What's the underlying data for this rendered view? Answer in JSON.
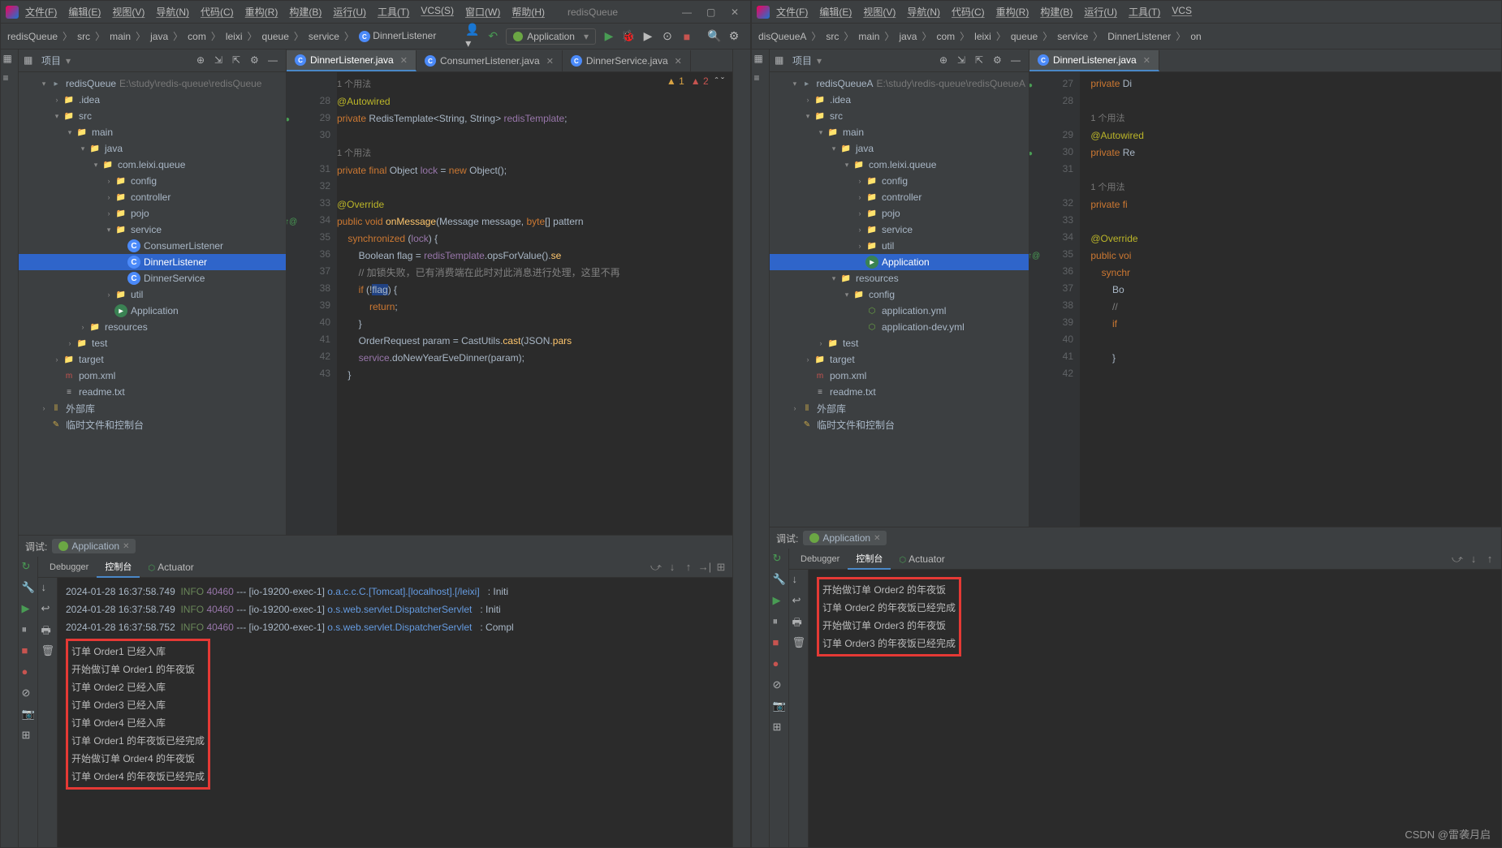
{
  "left": {
    "menu": [
      "文件(F)",
      "编辑(E)",
      "视图(V)",
      "导航(N)",
      "代码(C)",
      "重构(R)",
      "构建(B)",
      "运行(U)",
      "工具(T)",
      "VCS(S)",
      "窗口(W)",
      "帮助(H)"
    ],
    "title": "redisQueue",
    "breadcrumbs": [
      "redisQueue",
      "src",
      "main",
      "java",
      "com",
      "leixi",
      "queue",
      "service",
      "DinnerListener"
    ],
    "runConfig": "Application",
    "projectLabel": "项目",
    "projectRoot": {
      "name": "redisQueue",
      "path": "E:\\study\\redis-queue\\redisQueue"
    },
    "tree": [
      {
        "d": 1,
        "arr": "▾",
        "i": "proj",
        "t": "redisQueue",
        "path": "E:\\study\\redis-queue\\redisQueue"
      },
      {
        "d": 2,
        "arr": "›",
        "i": "folder",
        "t": ".idea"
      },
      {
        "d": 2,
        "arr": "▾",
        "i": "folder",
        "t": "src"
      },
      {
        "d": 3,
        "arr": "▾",
        "i": "folder",
        "t": "main"
      },
      {
        "d": 4,
        "arr": "▾",
        "i": "folder",
        "t": "java"
      },
      {
        "d": 5,
        "arr": "▾",
        "i": "folder",
        "t": "com.leixi.queue"
      },
      {
        "d": 6,
        "arr": "›",
        "i": "folder",
        "t": "config"
      },
      {
        "d": 6,
        "arr": "›",
        "i": "folder",
        "t": "controller"
      },
      {
        "d": 6,
        "arr": "›",
        "i": "folder",
        "t": "pojo"
      },
      {
        "d": 6,
        "arr": "▾",
        "i": "folder",
        "t": "service"
      },
      {
        "d": 7,
        "arr": "",
        "i": "cls",
        "t": "ConsumerListener"
      },
      {
        "d": 7,
        "arr": "",
        "i": "cls",
        "t": "DinnerListener",
        "sel": true
      },
      {
        "d": 7,
        "arr": "",
        "i": "cls",
        "t": "DinnerService"
      },
      {
        "d": 6,
        "arr": "›",
        "i": "folder",
        "t": "util"
      },
      {
        "d": 6,
        "arr": "",
        "i": "clsm",
        "t": "Application"
      },
      {
        "d": 4,
        "arr": "›",
        "i": "folder",
        "t": "resources"
      },
      {
        "d": 3,
        "arr": "›",
        "i": "folder",
        "t": "test"
      },
      {
        "d": 2,
        "arr": "›",
        "i": "folder-o",
        "t": "target"
      },
      {
        "d": 2,
        "arr": "",
        "i": "xml",
        "t": "pom.xml"
      },
      {
        "d": 2,
        "arr": "",
        "i": "txt",
        "t": "readme.txt"
      },
      {
        "d": 1,
        "arr": "›",
        "i": "lib",
        "t": "外部库"
      },
      {
        "d": 1,
        "arr": "",
        "i": "scratch",
        "t": "临时文件和控制台"
      }
    ],
    "tabs": [
      {
        "name": "DinnerListener.java",
        "active": true
      },
      {
        "name": "ConsumerListener.java"
      },
      {
        "name": "DinnerService.java"
      }
    ],
    "warnings": {
      "warn": "1",
      "weak": "2"
    },
    "hint": "1 个用法",
    "code": [
      {
        "n": "",
        "html": "<span class='hint'>1 个用法</span>"
      },
      {
        "n": "28",
        "html": "<span class='ann'>@Autowired</span>"
      },
      {
        "n": "29",
        "ic": "●",
        "html": "<span class='kw'>private</span> RedisTemplate&lt;String, String&gt; <span class='fld'>redisTemplate</span>;"
      },
      {
        "n": "30",
        "html": ""
      },
      {
        "n": "",
        "html": "<span class='hint'>1 个用法</span>"
      },
      {
        "n": "31",
        "html": "<span class='kw'>private final</span> Object <span class='fld'>lock</span> = <span class='kw'>new</span> Object();"
      },
      {
        "n": "32",
        "html": ""
      },
      {
        "n": "33",
        "html": "<span class='ann'>@Override</span>"
      },
      {
        "n": "34",
        "ic": "↑@",
        "html": "<span class='kw'>public void</span> <span class='fn'>onMessage</span>(Message message, <span class='kw'>byte</span>[] pattern"
      },
      {
        "n": "35",
        "html": "    <span class='kw'>synchronized</span> (<span class='fld'>lock</span>) {"
      },
      {
        "n": "36",
        "html": "        Boolean flag = <span class='fld'>redisTemplate</span>.opsForValue().<span class='fn'>se</span>"
      },
      {
        "n": "37",
        "html": "        <span class='com'>// 加锁失败，已有消费端在此时对此消息进行处理，这里不再</span>"
      },
      {
        "n": "38",
        "html": "        <span class='kw'>if</span> (!<span style='background:#214283'>flag</span>) {"
      },
      {
        "n": "39",
        "html": "            <span class='kw'>return</span>;"
      },
      {
        "n": "40",
        "html": "        }"
      },
      {
        "n": "41",
        "html": "        OrderRequest param = CastUtils.<span class='fn'>cast</span>(JSON.<span class='fn'>pars</span>"
      },
      {
        "n": "42",
        "html": "        <span class='fld'>service</span>.doNewYearEveDinner(param);"
      },
      {
        "n": "43",
        "html": "    }"
      }
    ],
    "debugLabel": "调试:",
    "debugTab": "Application",
    "subtabs": [
      "Debugger",
      "控制台",
      "Actuator"
    ],
    "subtabActive": 1,
    "logLines": [
      {
        "ts": "2024-01-28 16:37:58.749",
        "lvl": "INFO",
        "pid": "40460",
        "thread": "[io-19200-exec-1]",
        "logger": "o.a.c.c.C.[Tomcat].[localhost].[/leixi]",
        "msg": ": Initi"
      },
      {
        "ts": "2024-01-28 16:37:58.749",
        "lvl": "INFO",
        "pid": "40460",
        "thread": "[io-19200-exec-1]",
        "logger": "o.s.web.servlet.DispatcherServlet",
        "msg": ": Initi"
      },
      {
        "ts": "2024-01-28 16:37:58.752",
        "lvl": "INFO",
        "pid": "40460",
        "thread": "[io-19200-exec-1]",
        "logger": "o.s.web.servlet.DispatcherServlet",
        "msg": ": Compl"
      }
    ],
    "boxed": [
      "订单 Order1 已经入库",
      "开始做订单 Order1 的年夜饭",
      "订单 Order2 已经入库",
      "订单 Order3 已经入库",
      "订单 Order4 已经入库",
      "订单 Order1 的年夜饭已经完成",
      "开始做订单 Order4 的年夜饭",
      "订单 Order4 的年夜饭已经完成"
    ]
  },
  "right": {
    "menu": [
      "文件(F)",
      "编辑(E)",
      "视图(V)",
      "导航(N)",
      "代码(C)",
      "重构(R)",
      "构建(B)",
      "运行(U)",
      "工具(T)",
      "VCS"
    ],
    "breadcrumbs": [
      "disQueueA",
      "src",
      "main",
      "java",
      "com",
      "leixi",
      "queue",
      "service",
      "DinnerListener",
      "on"
    ],
    "projectLabel": "项目",
    "tree": [
      {
        "d": 1,
        "arr": "▾",
        "i": "proj",
        "t": "redisQueueA",
        "path": "E:\\study\\redis-queue\\redisQueueA"
      },
      {
        "d": 2,
        "arr": "›",
        "i": "folder",
        "t": ".idea"
      },
      {
        "d": 2,
        "arr": "▾",
        "i": "folder",
        "t": "src"
      },
      {
        "d": 3,
        "arr": "▾",
        "i": "folder",
        "t": "main"
      },
      {
        "d": 4,
        "arr": "▾",
        "i": "folder",
        "t": "java"
      },
      {
        "d": 5,
        "arr": "▾",
        "i": "folder",
        "t": "com.leixi.queue"
      },
      {
        "d": 6,
        "arr": "›",
        "i": "folder",
        "t": "config"
      },
      {
        "d": 6,
        "arr": "›",
        "i": "folder",
        "t": "controller"
      },
      {
        "d": 6,
        "arr": "›",
        "i": "folder",
        "t": "pojo"
      },
      {
        "d": 6,
        "arr": "›",
        "i": "folder",
        "t": "service"
      },
      {
        "d": 6,
        "arr": "›",
        "i": "folder",
        "t": "util"
      },
      {
        "d": 6,
        "arr": "",
        "i": "clsm",
        "t": "Application",
        "sel": true
      },
      {
        "d": 4,
        "arr": "▾",
        "i": "folder",
        "t": "resources"
      },
      {
        "d": 5,
        "arr": "▾",
        "i": "folder",
        "t": "config"
      },
      {
        "d": 6,
        "arr": "",
        "i": "yml",
        "t": "application.yml"
      },
      {
        "d": 6,
        "arr": "",
        "i": "yml",
        "t": "application-dev.yml"
      },
      {
        "d": 3,
        "arr": "›",
        "i": "folder",
        "t": "test"
      },
      {
        "d": 2,
        "arr": "›",
        "i": "folder-o",
        "t": "target"
      },
      {
        "d": 2,
        "arr": "",
        "i": "xml",
        "t": "pom.xml"
      },
      {
        "d": 2,
        "arr": "",
        "i": "txt",
        "t": "readme.txt"
      },
      {
        "d": 1,
        "arr": "›",
        "i": "lib",
        "t": "外部库"
      },
      {
        "d": 1,
        "arr": "",
        "i": "scratch",
        "t": "临时文件和控制台"
      }
    ],
    "tabs": [
      {
        "name": "DinnerListener.java",
        "active": true
      }
    ],
    "code": [
      {
        "n": "27",
        "ic": "●",
        "html": "    <span class='kw'>private</span> Di"
      },
      {
        "n": "28",
        "html": ""
      },
      {
        "n": "",
        "html": "    <span class='hint'>1 个用法</span>"
      },
      {
        "n": "29",
        "html": "    <span class='ann'>@Autowired</span>"
      },
      {
        "n": "30",
        "ic": "●",
        "html": "    <span class='kw'>private</span> Re"
      },
      {
        "n": "31",
        "html": ""
      },
      {
        "n": "",
        "html": "    <span class='hint'>1 个用法</span>"
      },
      {
        "n": "32",
        "html": "    <span class='kw'>private fi</span>"
      },
      {
        "n": "33",
        "html": ""
      },
      {
        "n": "34",
        "html": "    <span class='ann'>@Override</span>"
      },
      {
        "n": "35",
        "ic": "↑@",
        "html": "    <span class='kw'>public voi</span>"
      },
      {
        "n": "36",
        "html": "        <span class='kw'>synchr</span>"
      },
      {
        "n": "37",
        "html": "            Bo"
      },
      {
        "n": "38",
        "html": "            <span class='com'>//</span>"
      },
      {
        "n": "39",
        "html": "            <span class='kw'>if</span>"
      },
      {
        "n": "40",
        "html": ""
      },
      {
        "n": "41",
        "html": "            }"
      },
      {
        "n": "42",
        "html": ""
      }
    ],
    "debugLabel": "调试:",
    "debugTab": "Application",
    "subtabs": [
      "Debugger",
      "控制台",
      "Actuator"
    ],
    "subtabActive": 1,
    "boxed": [
      "开始做订单 Order2 的年夜饭",
      "订单 Order2 的年夜饭已经完成",
      "开始做订单 Order3 的年夜饭",
      "订单 Order3 的年夜饭已经完成"
    ]
  },
  "watermark": "CSDN @雷袭月启"
}
